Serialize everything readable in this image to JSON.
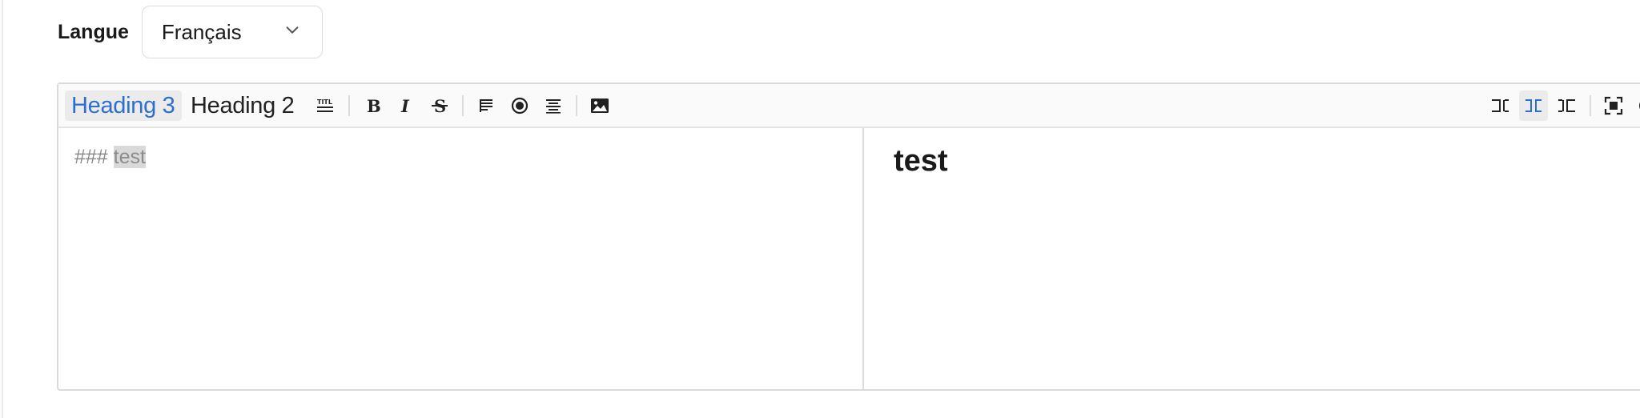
{
  "language": {
    "label": "Langue",
    "selected": "Français"
  },
  "toolbar": {
    "heading3": "Heading 3",
    "heading2": "Heading 2",
    "icons_left": [
      "title-icon",
      "bold-icon",
      "italic-icon",
      "strikethrough-icon",
      "paragraph-align-icon",
      "record-icon",
      "align-center-icon",
      "image-icon"
    ],
    "icons_right": [
      "editor-only-icon",
      "split-view-icon",
      "preview-only-icon",
      "fullscreen-icon"
    ],
    "active_color": "#2d6fd1"
  },
  "editor": {
    "source_prefix": "###",
    "source_text": "test"
  },
  "preview": {
    "heading": "test"
  }
}
